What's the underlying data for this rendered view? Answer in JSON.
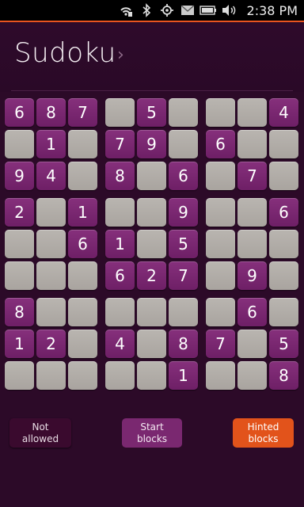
{
  "status_bar": {
    "time": "2:38 PM",
    "icons": [
      "wifi-icon",
      "bluetooth-icon",
      "location-icon",
      "mail-icon",
      "battery-icon",
      "volume-icon"
    ],
    "accent_color": "#e95420"
  },
  "header": {
    "title": "Sudoku",
    "chevron": "›"
  },
  "board": {
    "rows": [
      [
        "6",
        "8",
        "7",
        "",
        "5",
        "",
        "",
        "",
        "4"
      ],
      [
        "",
        "1",
        "",
        "7",
        "9",
        "",
        "6",
        "",
        ""
      ],
      [
        "9",
        "4",
        "",
        "8",
        "",
        "6",
        "",
        "7",
        ""
      ],
      [
        "2",
        "",
        "1",
        "",
        "",
        "9",
        "",
        "",
        "6"
      ],
      [
        "",
        "",
        "6",
        "1",
        "",
        "5",
        "",
        "",
        ""
      ],
      [
        "",
        "",
        "",
        "6",
        "2",
        "7",
        "",
        "9",
        ""
      ],
      [
        "8",
        "",
        "",
        "",
        "",
        "",
        "",
        "6",
        ""
      ],
      [
        "1",
        "2",
        "",
        "4",
        "",
        "8",
        "7",
        "",
        "5"
      ],
      [
        "",
        "",
        "",
        "",
        "",
        "1",
        "",
        "",
        "8"
      ]
    ],
    "given_color": "#7a2870",
    "empty_color": "#b2aea9"
  },
  "legend": {
    "not_allowed": "Not\nallowed",
    "start_blocks": "Start\nblocks",
    "hinted_blocks": "Hinted\nblocks",
    "not_allowed_color": "#3a0a2e",
    "start_color": "#7a2870",
    "hinted_color": "#e2531b"
  }
}
